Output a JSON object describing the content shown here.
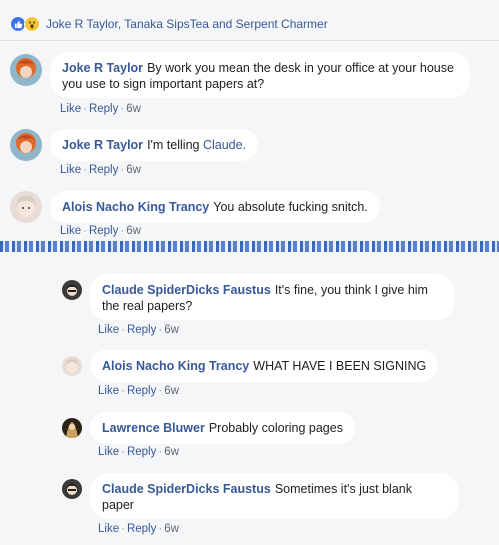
{
  "reactions": {
    "names": "Joke R Taylor, Tanaka SipsTea and Serpent Charmer"
  },
  "actions": {
    "like": "Like",
    "reply": "Reply",
    "sep": "·",
    "time": "6w"
  },
  "comments": [
    {
      "author": "Joke R Taylor",
      "text": "By work you mean the desk in your office at your house you use to sign important papers at?"
    },
    {
      "author": "Joke R Taylor",
      "text": "I'm telling ",
      "mention": "Claude."
    },
    {
      "author": "Alois Nacho King Trancy",
      "text": "You absolute fucking snitch."
    }
  ],
  "replies": [
    {
      "author": "Claude SpiderDicks Faustus",
      "text": "It's fine, you think I give him the real papers?"
    },
    {
      "author": "Alois Nacho King Trancy",
      "text": "WHAT HAVE I BEEN SIGNING"
    },
    {
      "author": "Lawrence Bluwer",
      "text": "Probably coloring pages"
    },
    {
      "author": "Claude SpiderDicks Faustus",
      "text": "Sometimes it's just blank paper"
    }
  ]
}
